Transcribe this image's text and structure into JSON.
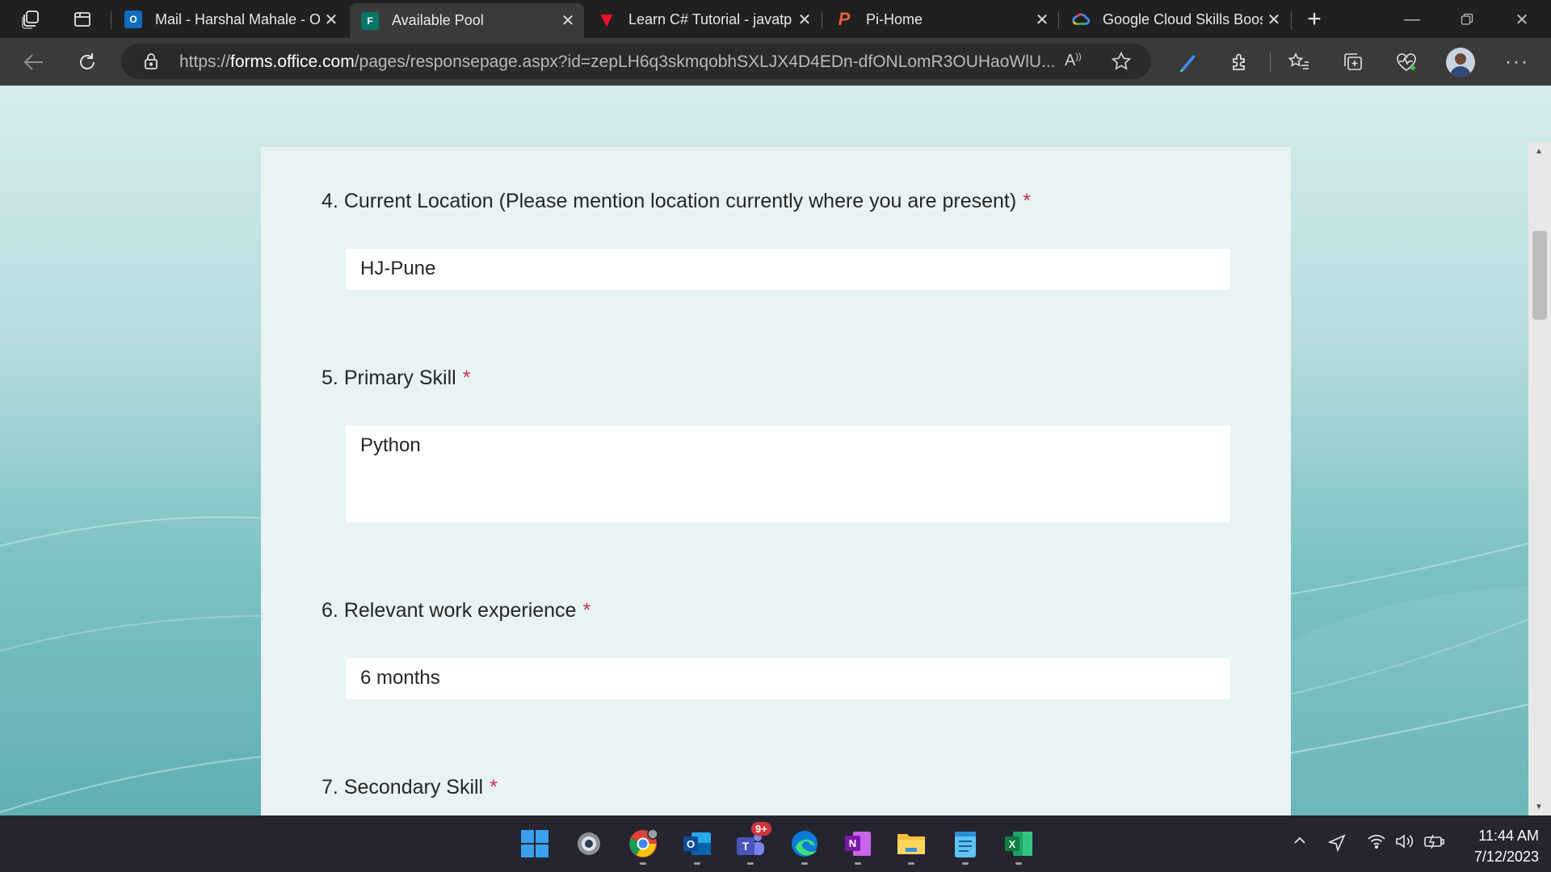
{
  "browser": {
    "tabs": [
      {
        "title": "Mail - Harshal Mahale - O",
        "icon": "outlook-icon",
        "color": "#0f6cbd",
        "active": false
      },
      {
        "title": "Available Pool",
        "icon": "forms-icon",
        "color": "#077568",
        "active": true
      },
      {
        "title": "Learn C# Tutorial - javatp",
        "icon": "javatpoint-icon",
        "color": "#e81123",
        "active": false
      },
      {
        "title": "Pi-Home",
        "icon": "pi-icon",
        "color": "#e8623a",
        "active": false
      },
      {
        "title": "Google Cloud Skills Boost",
        "icon": "google-cloud-icon",
        "color": "#4285f4",
        "active": false
      }
    ],
    "url_prefix": "https://",
    "url_domain": "forms.office.com",
    "url_path": "/pages/responsepage.aspx?id=zepLH6q3skmqobhSXLJX4D4EDn-dfONLomR3OUHaoWlU..."
  },
  "form": {
    "questions": [
      {
        "number": "4.",
        "label": "Current Location (Please mention location currently where you are present)",
        "required": "*",
        "answer": "HJ-Pune"
      },
      {
        "number": "5.",
        "label": "Primary Skill",
        "required": "*",
        "answer": "Python"
      },
      {
        "number": "6.",
        "label": "Relevant work experience",
        "required": "*",
        "answer": "6 months"
      },
      {
        "number": "7.",
        "label": "Secondary Skill",
        "required": "*",
        "answer": ""
      }
    ]
  },
  "taskbar": {
    "apps": [
      "windows-start-icon",
      "settings-icon",
      "chrome-icon",
      "outlook-icon",
      "teams-icon",
      "edge-icon",
      "onenote-icon",
      "file-explorer-icon",
      "notepad-icon",
      "excel-icon"
    ],
    "teams_badge": "9+",
    "time": "11:44 AM",
    "date": "7/12/2023"
  }
}
